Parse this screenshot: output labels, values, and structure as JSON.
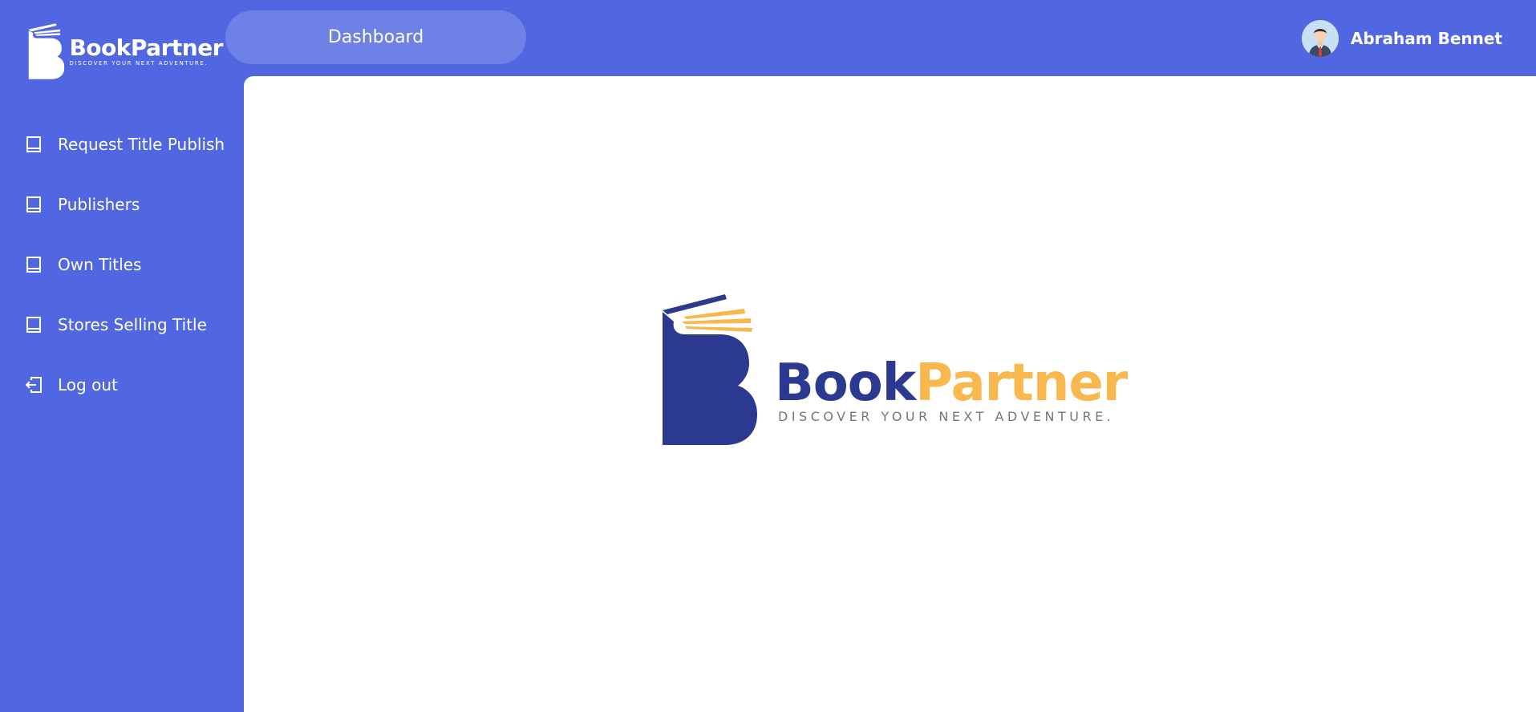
{
  "logo": {
    "name_part1": "Book",
    "name_part2": "Partner",
    "name_full": "BookPartner",
    "tagline": "DISCOVER YOUR NEXT ADVENTURE."
  },
  "header": {
    "dashboard_label": "Dashboard",
    "user_name": "Abraham Bennet"
  },
  "sidebar": {
    "items": [
      {
        "label": "Request Title Publish",
        "icon": "book-icon"
      },
      {
        "label": "Publishers",
        "icon": "book-icon"
      },
      {
        "label": "Own Titles",
        "icon": "book-icon"
      },
      {
        "label": "Stores Selling Title",
        "icon": "book-icon"
      },
      {
        "label": "Log out",
        "icon": "logout-icon"
      }
    ]
  },
  "colors": {
    "primary": "#5067e1",
    "pill": "#6e81e7",
    "brand_blue": "#2b3990",
    "brand_orange": "#f8b84d",
    "panel": "#ffffff"
  }
}
